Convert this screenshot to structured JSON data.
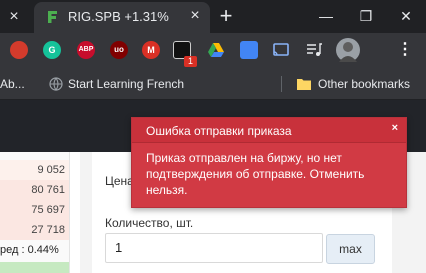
{
  "browser": {
    "active_tab_title": "RIG.SPB +1.31%",
    "inactive_tab_close": "×",
    "tab_close": "×",
    "new_tab": "+",
    "window_controls": {
      "minimize": "—",
      "restore": "❐",
      "close": "✕"
    }
  },
  "toolbar": {
    "extensions": [
      {
        "name": "santa-extension-icon",
        "label": "",
        "color": "#d33b2c"
      },
      {
        "name": "grammarly-icon",
        "label": "G",
        "color": "#15c39a"
      },
      {
        "name": "adblock-plus-icon",
        "label": "ABP",
        "color": "#c70d2c"
      },
      {
        "name": "ublock-origin-icon",
        "label": "uo",
        "color": "#800000"
      },
      {
        "name": "gmail-icon",
        "label": "M",
        "color": "#d93025"
      },
      {
        "name": "dark-extension-icon",
        "label": "",
        "color": "#111111"
      },
      {
        "name": "google-drive-icon",
        "label": "",
        "color": "#34a853"
      },
      {
        "name": "translate-icon",
        "label": "",
        "color": "#4285f4"
      },
      {
        "name": "cast-icon",
        "label": "",
        "color": "#8ab4f8"
      },
      {
        "name": "media-control-icon",
        "label": "",
        "color": "#e8eaed"
      },
      {
        "name": "profile-avatar",
        "label": "",
        "color": "#9aa0a6"
      },
      {
        "name": "menu-kebab-icon",
        "label": "⋮",
        "color": "#e8eaed"
      }
    ],
    "extension_badge": "1"
  },
  "bookmarks": {
    "item_1": "Ab...",
    "item_2": "Start Learning French",
    "other": "Other bookmarks"
  },
  "order_book": {
    "values": [
      "9 052",
      "80 761",
      "75 697",
      "27 718",
      "ред : 0.44%"
    ]
  },
  "form": {
    "price_label": "Цена",
    "quantity_label": "Количество, шт.",
    "quantity_value": "1",
    "max_button": "max"
  },
  "toast": {
    "title": "Ошибка отправки приказа",
    "close": "×",
    "message": "Приказ отправлен на биржу, но нет подтверждения об отправке. Отменить нельзя.",
    "color": "#d13a44"
  }
}
